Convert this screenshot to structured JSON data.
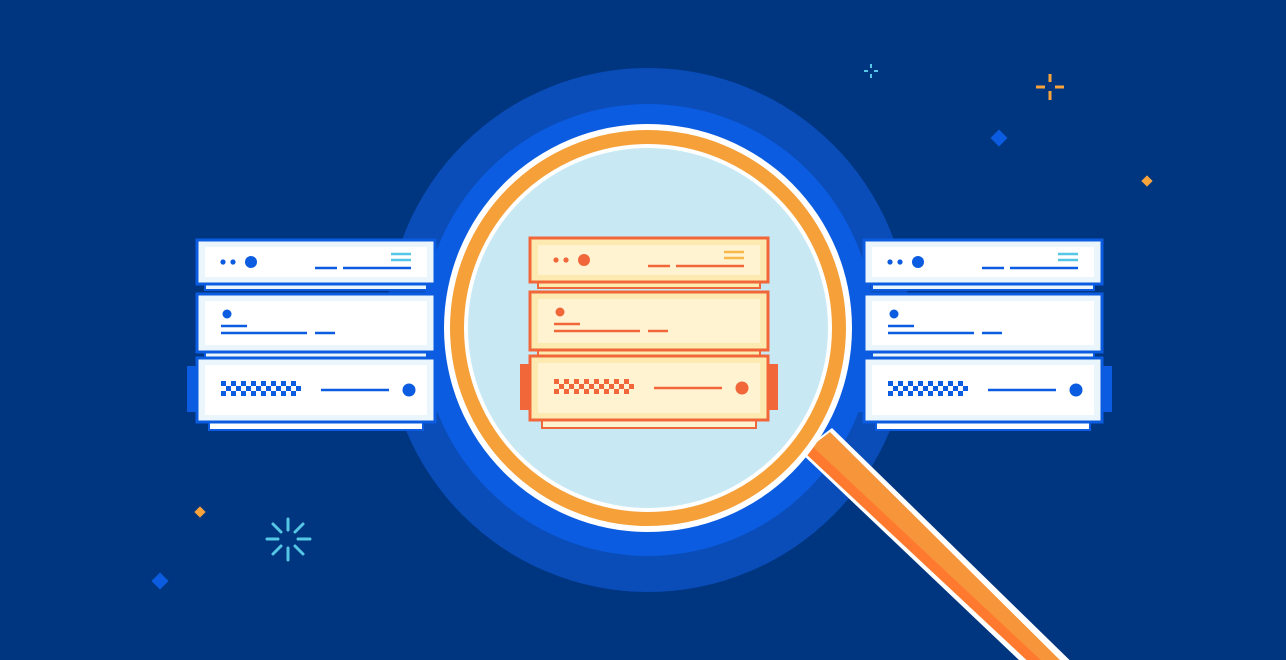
{
  "illustration": {
    "subject": "",
    "colors": {
      "background": "#00367f",
      "glow_outer": "#0a4cb8",
      "glow_inner": "#0b5ce0",
      "lens_fill": "#c8e9f4",
      "lens_ring": "#f6a03a",
      "handle": "#f7953a",
      "server_blue_fill": "#eaf6fb",
      "server_blue_stroke": "#0b5ce0",
      "server_blue_accent": "#56c6e6",
      "server_orange_fill": "#fdeab0",
      "server_orange_stroke": "#f2673a",
      "server_orange_accent": "#f9b84a",
      "sparkle_light_blue": "#56c6e6",
      "sparkle_orange": "#f9a33d",
      "diamond_blue": "#0b5ce0"
    },
    "icons": [
      "server-rack-icon",
      "magnifying-glass-icon",
      "sparkle-icon",
      "diamond-icon",
      "burst-icon"
    ]
  }
}
